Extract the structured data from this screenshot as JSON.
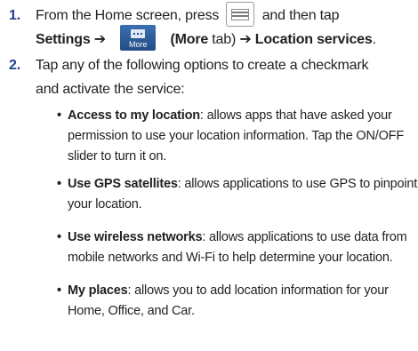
{
  "steps": [
    {
      "number": "1.",
      "line1_prefix": "From the Home screen, press",
      "line1_suffix": "and then tap",
      "line2_settings": "Settings ➔",
      "more_icon_label": "More",
      "line2_more_tab": "(More",
      "line2_tab": "tab)",
      "line2_arrow_target": "➔ Location services",
      "line2_end": "."
    },
    {
      "number": "2.",
      "line1": "Tap any of the following options to create a checkmark",
      "line2": "and activate the service:"
    }
  ],
  "bullets": [
    {
      "title": "Access to my location",
      "lines": [
        ": allows apps that have asked your",
        "permission to use your location information. Tap the ON/OFF",
        "slider to turn it on."
      ]
    },
    {
      "title": "Use GPS satellites",
      "lines": [
        ": allows applications to use GPS to pinpoint",
        "your location."
      ]
    },
    {
      "title": "Use wireless networks",
      "lines": [
        ": allows applications to use data from",
        "mobile networks and Wi-Fi to help determine your location."
      ]
    },
    {
      "title": "My places",
      "lines": [
        ": allows you to add location information for your",
        "Home, Office, and Car."
      ]
    }
  ],
  "bullet_symbol": "•",
  "icons": {
    "menu_key": "menu-key-icon",
    "more_tab": "more-tab-icon"
  },
  "colors": {
    "step_number": "#1f3f8f",
    "more_tab_background": "#2f5f9e",
    "text": "#231f20"
  }
}
